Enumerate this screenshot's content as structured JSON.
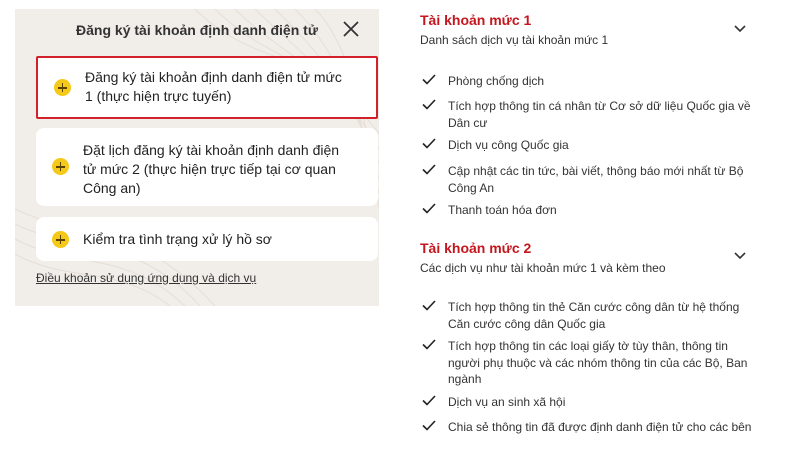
{
  "dialog": {
    "title": "Đăng ký tài khoản định danh điện tử",
    "options": [
      {
        "line1": "Đăng ký tài khoản định danh điện tử mức",
        "line2": "1 (thực hiện trực tuyến)"
      },
      {
        "line1": "Đặt lịch đăng ký tài khoản định danh điện",
        "line2": "tử mức 2 (thực hiện trực tiếp tại cơ quan",
        "line3": "Công an)"
      },
      {
        "line1": "Kiểm tra tình trạng xử lý hồ sơ"
      }
    ],
    "terms_link": "Điều khoản sử dụng ứng dụng và dịch vụ"
  },
  "tiers": [
    {
      "title": "Tài khoản mức 1",
      "subtitle": "Danh sách dịch vụ tài khoản mức 1",
      "features": [
        {
          "line1": "Phòng chống dịch"
        },
        {
          "line1": "Tích hợp thông tin cá nhân từ Cơ sở dữ liệu Quốc gia về",
          "line2": "Dân cư"
        },
        {
          "line1": "Dịch vụ công Quốc gia"
        },
        {
          "line1": "Cập nhật các tin tức, bài viết, thông báo mới nhất từ Bộ",
          "line2": "Công An"
        },
        {
          "line1": "Thanh toán hóa đơn"
        }
      ]
    },
    {
      "title": "Tài khoản mức 2",
      "subtitle": "Các dịch vụ như tài khoản mức 1 và kèm theo",
      "features": [
        {
          "line1": "Tích hợp thông tin thẻ Căn cước công dân từ hệ thống",
          "line2": "Căn cước công dân Quốc gia"
        },
        {
          "line1": "Tích hợp thông tin các loại giấy tờ tùy thân, thông tin",
          "line2": "người phụ thuộc và các nhóm thông tin của các Bộ, Ban",
          "line3": "ngành"
        },
        {
          "line1": "Dịch vụ an sinh xã hội"
        },
        {
          "line1": "Chia sẻ thông tin đã được định danh điện tử cho các bên"
        }
      ]
    }
  ],
  "colors": {
    "accent": "#c4161c",
    "plus_icon": "#f5c919",
    "panel_bg": "#f1ede9"
  }
}
